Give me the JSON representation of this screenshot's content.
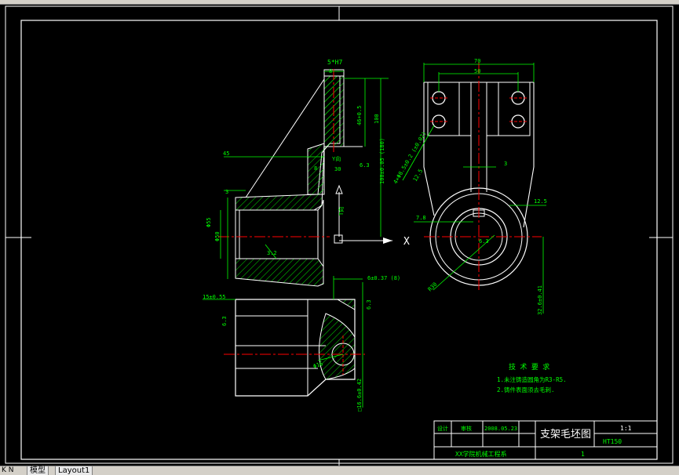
{
  "tabs": {
    "nav": "K  N",
    "model": "模型",
    "layout": "Layout1"
  },
  "colors": {
    "bg": "#000000",
    "line": "#ffffff",
    "dim": "#00ff00",
    "center": "#ff0000",
    "hatch": "#00ff00"
  },
  "front_view": {
    "dims": [
      "5*H7",
      "8",
      "46+0.5",
      "100",
      "45",
      "8",
      "Y向",
      "30",
      "6.3",
      "3",
      "100±0.05 (180)",
      "Φ55",
      "Φ50",
      "3.2",
      "T向"
    ]
  },
  "side_view": {
    "dims": [
      "70",
      "50",
      "4×Φ8.5±0.2 (±0.02)",
      "12.5",
      "3",
      "7.8",
      "12.5",
      "6.3",
      "R30",
      "32.6±0.41",
      "X"
    ]
  },
  "bottom_view": {
    "dims": [
      "6±0.37 (8)",
      "15±0.55",
      "6.3",
      "6.3",
      "Φ16",
      "□16.6±0.42"
    ]
  },
  "tech_notes": {
    "title": "技 术 要 求",
    "items": [
      "1.未注铸造圆角为R3-R5.",
      "2.铸件表面须去毛刺."
    ]
  },
  "title_block": {
    "drawing_title": "支架毛坯图",
    "scale": "1:1",
    "number": "HT150",
    "cell1": "设计",
    "cell2": "审核",
    "cell3": "2008.05.23",
    "school": "XX学院机械工程系",
    "sheet": "1"
  }
}
